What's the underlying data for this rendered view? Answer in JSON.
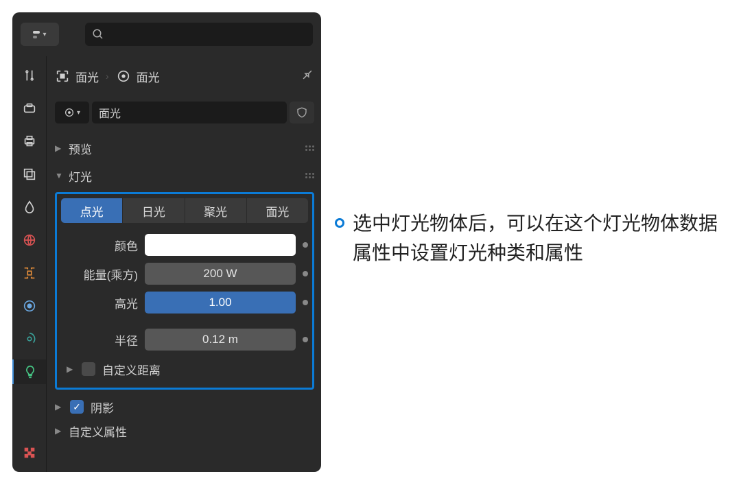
{
  "breadcrumb": {
    "object_label": "面光",
    "data_label": "面光"
  },
  "datablock": {
    "name": "面光"
  },
  "sections": {
    "preview": "预览",
    "light": "灯光",
    "custom_distance": "自定义距离",
    "shadow": "阴影",
    "custom_props": "自定义属性"
  },
  "light_types": {
    "point": "点光",
    "sun": "日光",
    "spot": "聚光",
    "area": "面光"
  },
  "props": {
    "color_label": "颜色",
    "energy_label": "能量(乘方)",
    "energy_value": "200 W",
    "specular_label": "高光",
    "specular_value": "1.00",
    "radius_label": "半径",
    "radius_value": "0.12 m"
  },
  "annotation": {
    "text": "选中灯光物体后，可以在这个灯光物体数据属性中设置灯光种类和属性"
  }
}
